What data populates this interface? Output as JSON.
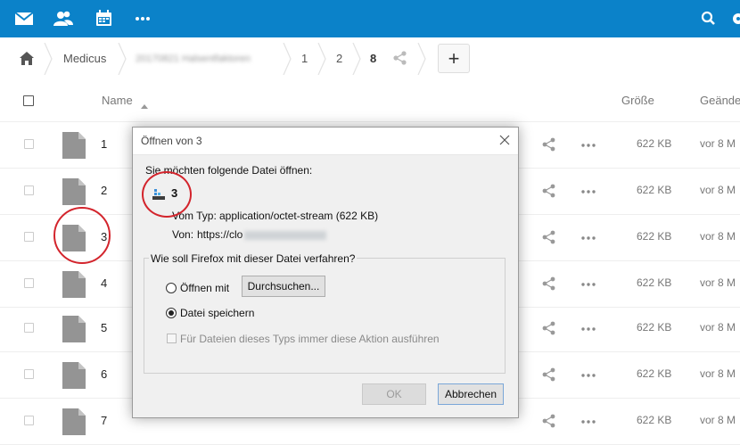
{
  "topbar": {
    "icons": [
      "mail-icon",
      "contacts-icon",
      "calendar-icon",
      "more-apps-icon",
      "search-icon",
      "settings-icon"
    ]
  },
  "breadcrumb": {
    "items": [
      "Medicus",
      "20170821 Halsentfaktoren",
      "1",
      "2",
      "8"
    ],
    "add_label": "+"
  },
  "table": {
    "header": {
      "name": "Name",
      "size": "Größe",
      "modified": "Geände"
    },
    "rows": [
      {
        "name": "1",
        "size": "622 KB",
        "modified": "vor 8 M"
      },
      {
        "name": "2",
        "size": "622 KB",
        "modified": "vor 8 M"
      },
      {
        "name": "3",
        "size": "622 KB",
        "modified": "vor 8 M"
      },
      {
        "name": "4",
        "size": "622 KB",
        "modified": "vor 8 M"
      },
      {
        "name": "5",
        "size": "622 KB",
        "modified": "vor 8 M"
      },
      {
        "name": "6",
        "size": "622 KB",
        "modified": "vor 8 M"
      },
      {
        "name": "7",
        "size": "622 KB",
        "modified": "vor 8 M"
      }
    ]
  },
  "dialog": {
    "title": "Öffnen von 3",
    "intro": "Sie möchten folgende Datei öffnen:",
    "filename": "3",
    "type_label": "Vom Typ:",
    "type_value": "application/octet-stream (622 KB)",
    "from_label": "Von:",
    "from_value": "https://clo",
    "group_label": "Wie soll Firefox mit dieser Datei verfahren?",
    "open_with_label": "Öffnen mit",
    "browse_label": "Durchsuchen...",
    "save_label": "Datei speichern",
    "always_label": "Für Dateien dieses Typs immer diese Aktion ausführen",
    "ok_label": "OK",
    "cancel_label": "Abbrechen",
    "selected_option": "Datei speichern"
  },
  "colors": {
    "topbar": "#0b82c9",
    "highlight_circle": "#d3242c"
  }
}
